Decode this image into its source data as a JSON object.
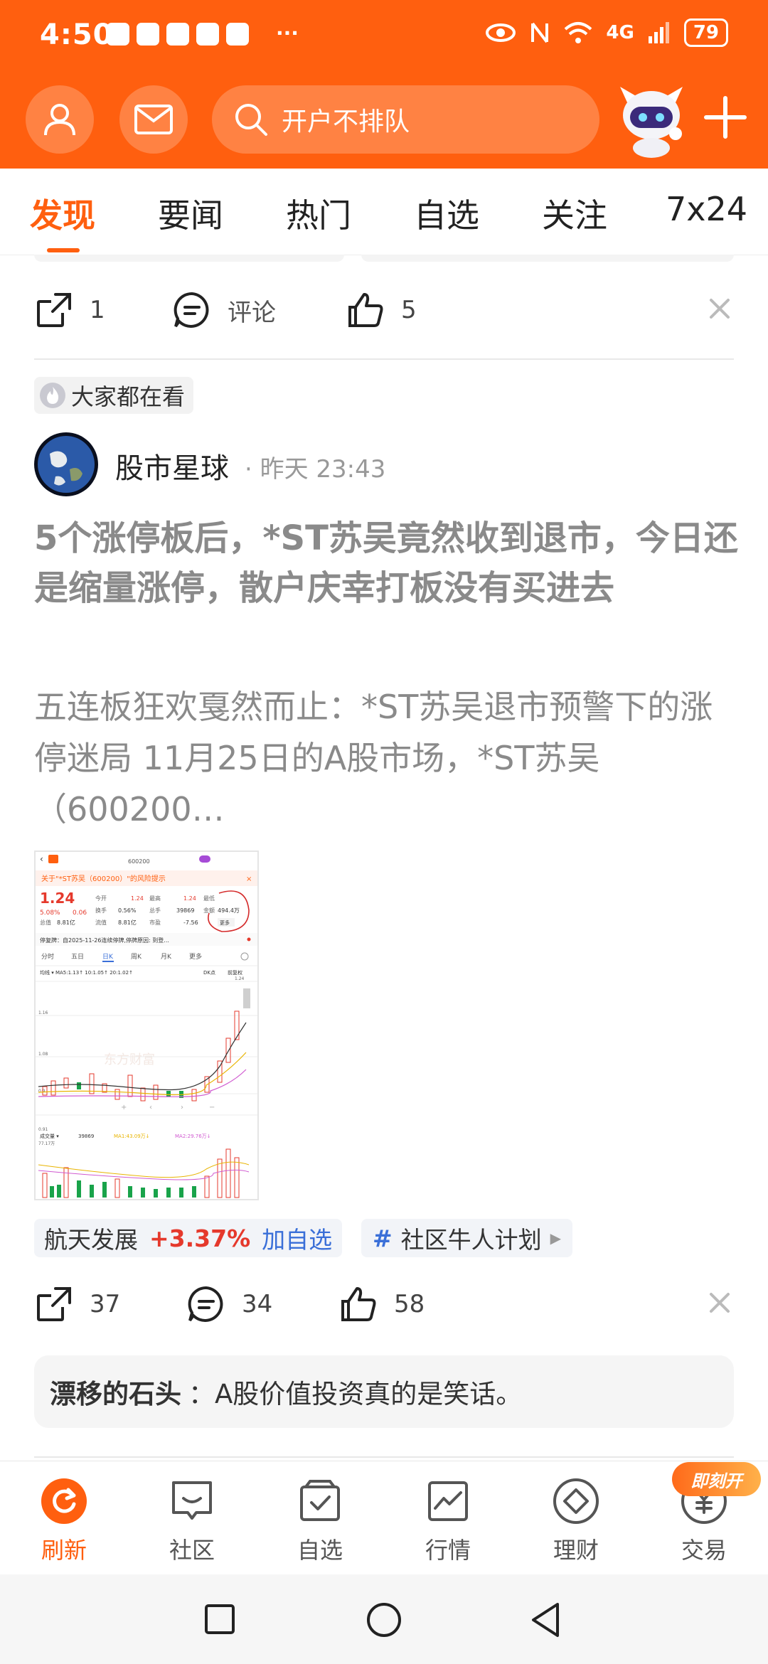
{
  "status_bar": {
    "time": "4:50",
    "dots": "···",
    "network": "4G",
    "battery": "79"
  },
  "header": {
    "search_placeholder": "开户不排队"
  },
  "tabs": [
    {
      "label": "发现"
    },
    {
      "label": "要闻"
    },
    {
      "label": "热门"
    },
    {
      "label": "自选"
    },
    {
      "label": "关注"
    },
    {
      "label": "7x24"
    }
  ],
  "prev_post": {
    "share_count": "1",
    "comment_label": "评论",
    "like_count": "5"
  },
  "post": {
    "hot_tag": "大家都在看",
    "author": "股市星球",
    "time": "· 昨天 23:43",
    "title": "5个涨停板后，*ST苏吴竟然收到退市，今日还是缩量涨停，散户庆幸打板没有买进去",
    "body": "五连板狂欢戛然而止：*ST苏吴退市预警下的涨停迷局 11月25日的A股市场，*ST苏吴（600200…",
    "stock": {
      "name": "航天发展",
      "change": "+3.37%",
      "add_label": "加自选"
    },
    "topic": {
      "hash": "#",
      "label": "社区牛人计划",
      "arrow": "▶"
    },
    "share_count": "37",
    "comment_count": "34",
    "like_count": "58",
    "top_comment": {
      "user": "漂移的石头",
      "text": "：A股价值投资真的是笑话。"
    }
  },
  "thumbnail": {
    "risk_notice": "关于\"*ST苏吴（600200）\"的风险提示",
    "code": "600200",
    "price": "1.24",
    "pct": "5.08%",
    "chg": "0.06",
    "today_open_label": "今开",
    "today_open": "1.24",
    "high_label": "最高",
    "high": "1.24",
    "low_label": "最低",
    "turnover_label": "换手",
    "turnover": "0.56%",
    "volume_label": "总手",
    "volume": "39869",
    "amount_label": "金额",
    "amount": "494.4万",
    "mcap_label": "总值",
    "mcap": "8.81亿",
    "float_label": "流值",
    "float": "8.81亿",
    "pe_label": "市盈",
    "pe": "-7.56",
    "more_label": "更多",
    "halt_notice": "停复牌：自2025-11-26连续停牌,停牌原因: 到登...",
    "period_tabs": [
      "分时",
      "五日",
      "日K",
      "周K",
      "月K",
      "更多"
    ],
    "ma_line": "均线 ▾  MA5:1.13↑  10:1.05↑  20:1.02↑",
    "dk_label": "DK点",
    "fq_label": "前复权",
    "y_top": "1.24",
    "y1": "1.16",
    "y2": "1.08",
    "y3": "0.9",
    "y4": "0.91",
    "y_vol": "77.17万",
    "vol_label": "成交量 ▾",
    "vol_value": "39869",
    "vol_ma1": "MA1:43.09万↓",
    "vol_ma2": "MA2:29.76万↓",
    "watermark": "东方财富"
  },
  "bottom_nav": [
    {
      "label": "刷新"
    },
    {
      "label": "社区"
    },
    {
      "label": "自选"
    },
    {
      "label": "行情"
    },
    {
      "label": "理财"
    },
    {
      "label": "交易"
    }
  ],
  "badge": "即刻开",
  "colors": {
    "brand": "#ff5f0f",
    "up_red": "#e5392c",
    "link_blue": "#3a6fd8",
    "dimmed_text": "#8a8a8a"
  }
}
